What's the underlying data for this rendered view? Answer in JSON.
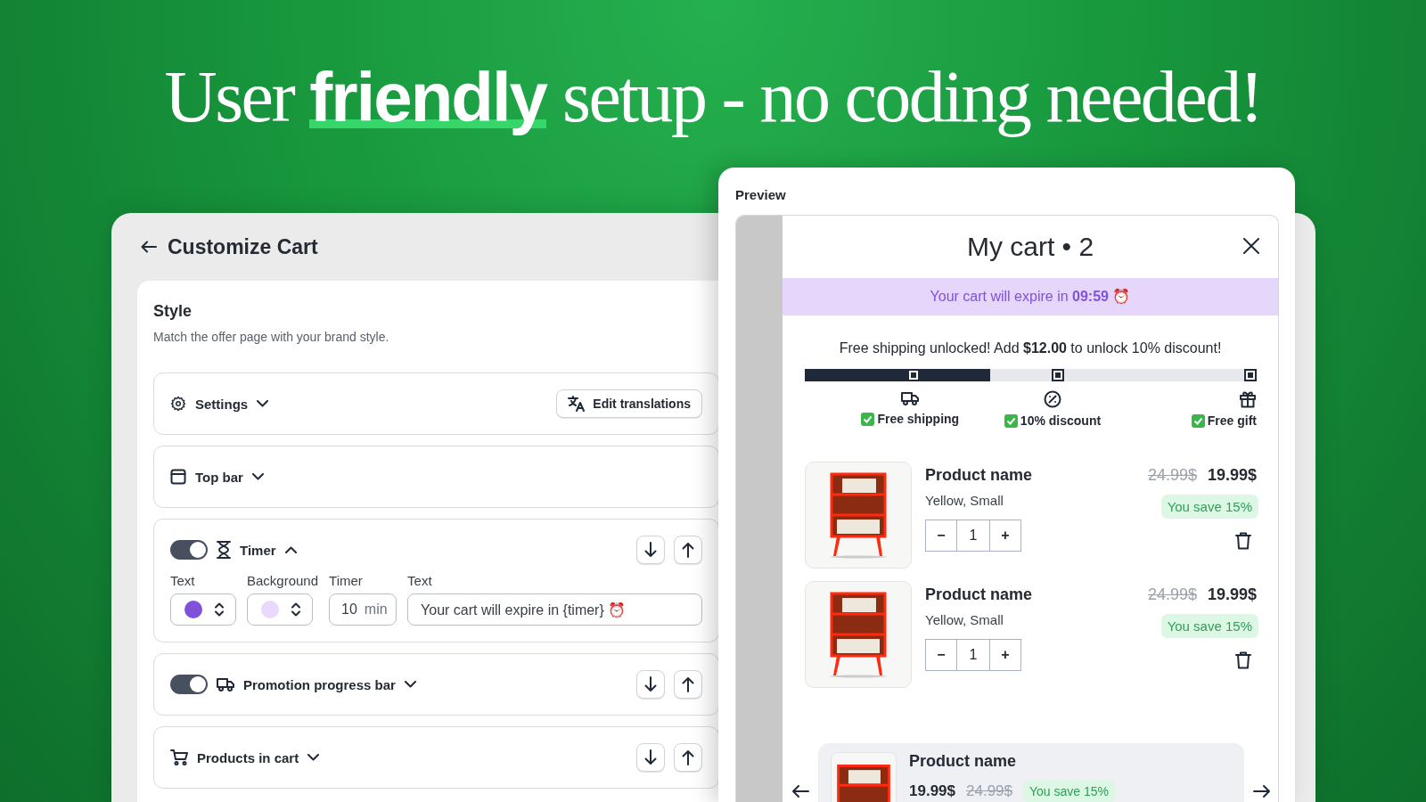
{
  "headline": {
    "before": "User",
    "highlight": "friendly",
    "after": "setup - no coding needed!"
  },
  "customize": {
    "title": "Customize Cart",
    "section_title": "Style",
    "section_description": "Match the offer page with your brand style.",
    "sections": [
      {
        "kind": "settings",
        "label": "Settings",
        "expanded": false,
        "action": "Edit translations",
        "movable": false
      },
      {
        "kind": "top_bar",
        "label": "Top bar",
        "expanded": false,
        "movable": false
      },
      {
        "kind": "timer",
        "label": "Timer",
        "on": true,
        "expanded": true,
        "movable": true,
        "fields": [
          {
            "kind": "color",
            "label": "Text",
            "color": "#8052dc"
          },
          {
            "kind": "color",
            "label": "Background",
            "color": "#e9d9fc"
          },
          {
            "kind": "number",
            "label": "Timer",
            "value": "10",
            "unit": "min"
          },
          {
            "kind": "text",
            "label": "Text",
            "value": "Your cart will expire in {timer} ⏰"
          }
        ]
      },
      {
        "kind": "progress_bar",
        "label": "Promotion progress bar",
        "on": true,
        "expanded": false,
        "movable": true
      },
      {
        "kind": "products",
        "label": "Products in cart",
        "expanded": false,
        "movable": true
      }
    ]
  },
  "preview": {
    "title": "Preview",
    "cart_title": "My cart • 2",
    "timer_banner": "Your cart will expire in **09:59** ⏰",
    "progress_message": "Free shipping unlocked! Add **$12.00** to unlock 10% discount!",
    "level": 0.41,
    "milestones": [
      {
        "kind": "shipping",
        "label": "Free shipping",
        "reached": true
      },
      {
        "kind": "discount",
        "label": "10% discount",
        "reached": true
      },
      {
        "kind": "gift",
        "label": "Free gift",
        "reached": true
      }
    ],
    "items": [
      {
        "name": "Product name",
        "variant": "Yellow, Small",
        "old_price": "24.99$",
        "price": "19.99$",
        "savings": "You save 15%",
        "quantity": "1",
        "minus": "−",
        "plus": "+"
      },
      {
        "name": "Product name",
        "variant": "Yellow, Small",
        "old_price": "24.99$",
        "price": "19.99$",
        "savings": "You save 15%",
        "quantity": "1",
        "minus": "−",
        "plus": "+"
      }
    ],
    "recommendation": {
      "name": "Product name",
      "price": "19.99$",
      "old_price": "24.99$",
      "savings": "You save 15%"
    }
  }
}
